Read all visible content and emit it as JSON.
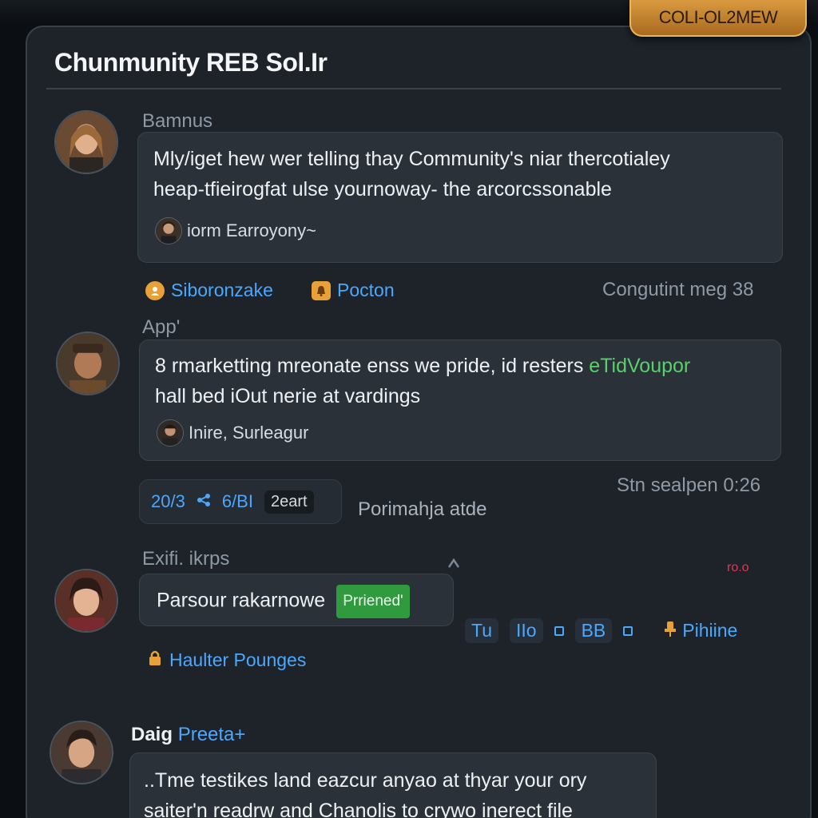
{
  "corner_badge": "COLI-OL2MEW",
  "header": {
    "title": "Chunmunity   REB Sol.Ir"
  },
  "posts": [
    {
      "username": "Bamnus",
      "message_line1": "Mly/iget hew wer telling thay Community's niar thercotialey",
      "message_line2": "heap-tfieirogfat ulse yournoway- the arcorcssonable",
      "mention": "iorm Earroyony~"
    },
    {
      "username": "App'",
      "message_line1": "8 rmarketting mreonate enss we pride, id resters",
      "message_highlight": "eTidVoupor",
      "message_line2": "hall bed iOut nerie at vardings",
      "mention": "Inire, Surleagur"
    },
    {
      "username": "Exifi. ikrps",
      "message": "Parsour rakarnowe",
      "tag": "Prriened'"
    },
    {
      "username_first": "Daig",
      "username_second": "Preeta+",
      "message_line1": "..Tme testikes land eazcur anyao at thyar your ory",
      "message_line2": "saiter'n readrw and Chanolis to crywo inerect file"
    }
  ],
  "post1_actions": {
    "link1": "Siboronzake",
    "link2": "Pocton",
    "meta": "Congutint meg 38"
  },
  "post2_stats": {
    "count1": "20/3",
    "count2": "6/BI",
    "chip": "2eart",
    "label": "Porimahja atde",
    "meta": "Stn sealpen 0:26"
  },
  "post3_actions": {
    "tool1": "Tu",
    "tool2": "IIo",
    "tool3": "BB",
    "link": "Pihiine",
    "link2": "Haulter Pounges",
    "alert": "ro.o"
  },
  "colors": {
    "accent": "#4aa8ff",
    "panel": "#1d2329",
    "bubble": "#2a3138",
    "badge": "#d99a3f",
    "green": "#59d06a"
  }
}
